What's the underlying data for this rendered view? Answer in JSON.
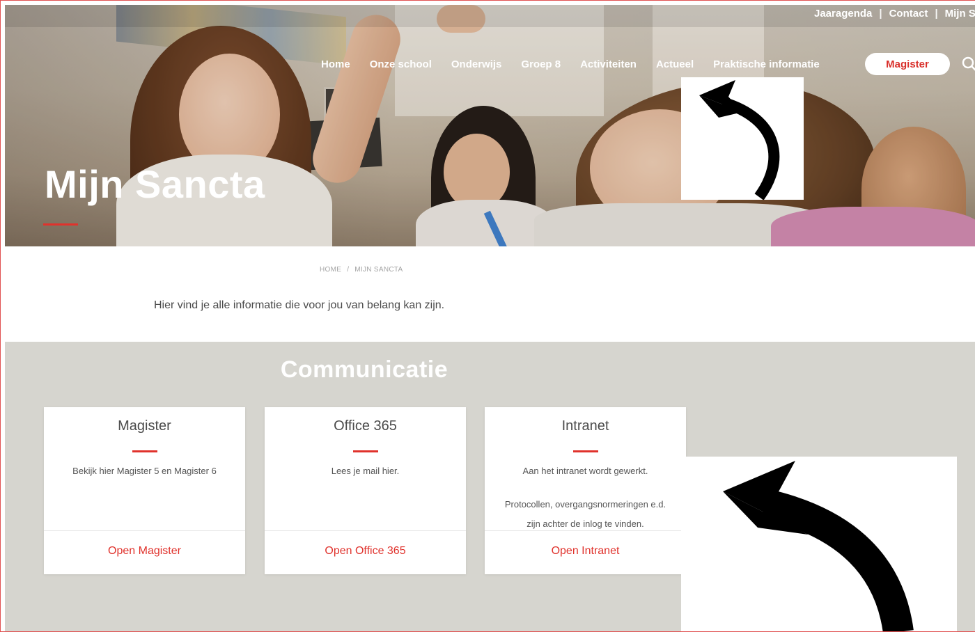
{
  "utility_nav": {
    "items": [
      "Jaaragenda",
      "Contact",
      "Mijn Sancta"
    ],
    "separator": "|"
  },
  "main_nav": {
    "items": [
      "Home",
      "Onze school",
      "Onderwijs",
      "Groep 8",
      "Activiteiten",
      "Actueel",
      "Praktische informatie"
    ],
    "cta_label": "Magister"
  },
  "hero": {
    "title": "Mijn Sancta"
  },
  "breadcrumb": {
    "home": "HOME",
    "separator": "/",
    "current": "MIJN SANCTA"
  },
  "intro": "Hier vind je alle informatie die voor jou van belang kan zijn.",
  "section": {
    "title": "Communicatie"
  },
  "cards": [
    {
      "title": "Magister",
      "text": "Bekijk hier Magister 5 en Magister 6",
      "link": "Open Magister"
    },
    {
      "title": "Office 365",
      "text": "Lees je mail hier.",
      "link": "Open Office 365"
    },
    {
      "title": "Intranet",
      "text_line1": "Aan het intranet wordt gewerkt.",
      "text_line2": "Protocollen, overgangsnormeringen e.d.",
      "text_line3": "zijn achter de inlog te vinden.",
      "link": "Open Intranet"
    }
  ],
  "icons": {
    "search": "search-icon",
    "arrow": "curved-arrow-icon"
  },
  "colors": {
    "accent": "#e0322c",
    "section_bg": "#d6d5cf",
    "text": "#4a4a4a"
  }
}
